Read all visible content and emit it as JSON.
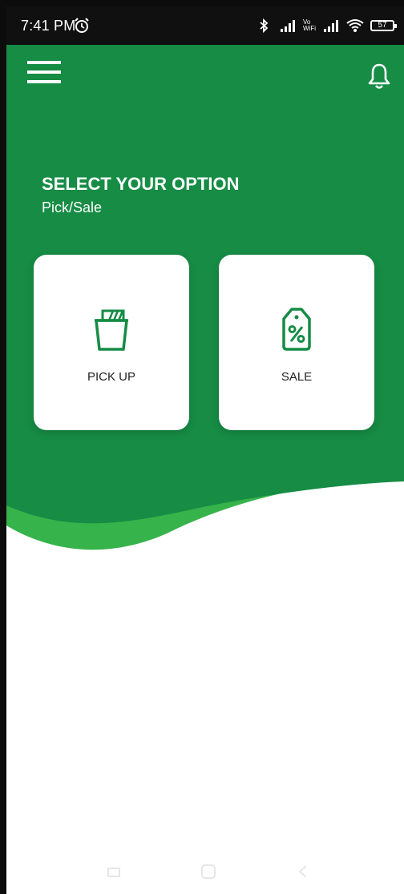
{
  "status_bar": {
    "time": "7:41 PM",
    "battery": "57",
    "network_label_top": "Vo",
    "network_label_bottom": "WiFi"
  },
  "header": {
    "menu_icon": "hamburger-menu-icon",
    "notification_icon": "bell-icon",
    "title": "SELECT YOUR OPTION",
    "subtitle": "Pick/Sale"
  },
  "options": [
    {
      "label": "PICK UP",
      "icon": "bag-icon"
    },
    {
      "label": "SALE",
      "icon": "discount-tag-icon"
    }
  ],
  "colors": {
    "primary": "#168c45",
    "wave_light": "#36b34a",
    "status_bar": "#101010"
  },
  "navigation": {
    "items": [
      "recents-icon",
      "home-icon",
      "back-icon"
    ]
  }
}
